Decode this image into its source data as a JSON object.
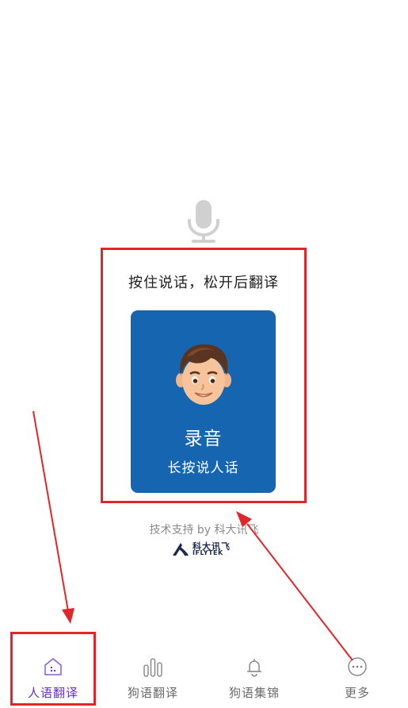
{
  "main": {
    "instruction": "按住说话，松开后翻译",
    "record_card": {
      "title": "录音",
      "subtitle": "长按说人话",
      "color": "#1565b0"
    },
    "support_text": "技术支持 by 科大讯飞",
    "logo": {
      "cn": "科大讯飞",
      "en": "IFLYTEK"
    }
  },
  "tabbar": {
    "items": [
      {
        "label": "人语翻译",
        "icon": "home-icon",
        "active": true
      },
      {
        "label": "狗语翻译",
        "icon": "bars-icon",
        "active": false
      },
      {
        "label": "狗语集锦",
        "icon": "bell-icon",
        "active": false
      },
      {
        "label": "更多",
        "icon": "more-icon",
        "active": false
      }
    ],
    "active_color": "#6a2fc4"
  },
  "annotation_color": "#e0262a"
}
